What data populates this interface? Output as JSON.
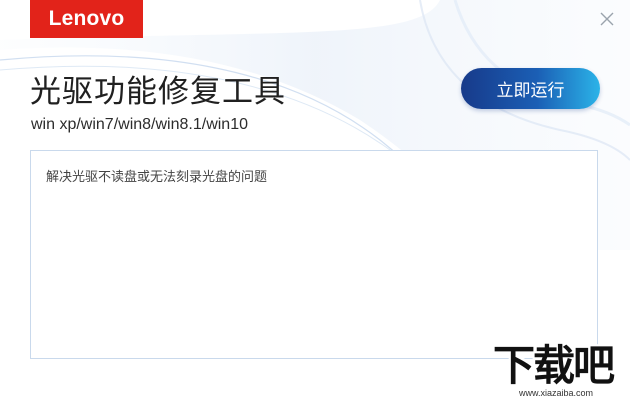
{
  "header": {
    "brand": "Lenovo",
    "title": "光驱功能修复工具",
    "subtitle": "win xp/win7/win8/win8.1/win10",
    "close_icon": "close-icon"
  },
  "actions": {
    "run_label": "立即运行"
  },
  "description": {
    "text": "解决光驱不读盘或无法刻录光盘的问题"
  },
  "watermark": {
    "main": "下载吧",
    "url": "www.xiazaiba.com"
  },
  "colors": {
    "brand_red": "#e2231a",
    "button_start": "#173a8a",
    "button_end": "#2bb3e8",
    "box_border": "#c9d9ec"
  }
}
